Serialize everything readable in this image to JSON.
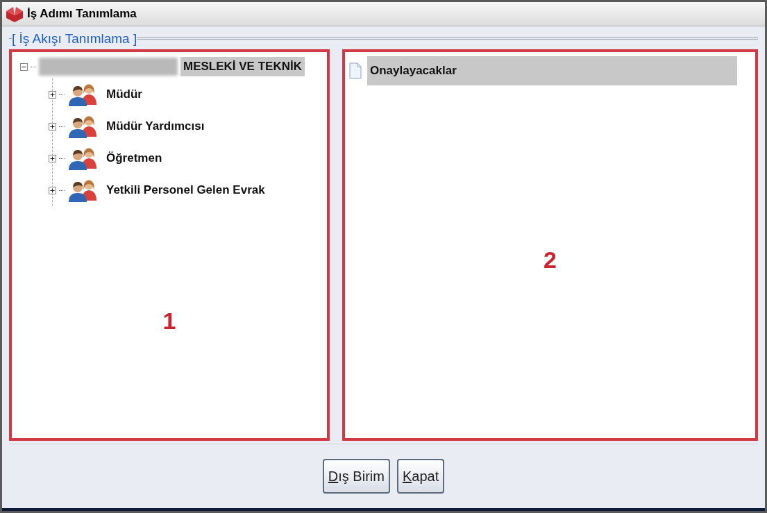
{
  "window": {
    "title": "İş Adımı Tanımlama"
  },
  "group": {
    "title": "[ İş Akışı Tanımlama ]"
  },
  "tree": {
    "root": {
      "label": "MESLEKİ VE TEKNİK",
      "expanded": true,
      "selected": true,
      "redacted": true,
      "children": [
        {
          "label": "Müdür",
          "expanded": false,
          "selected": false
        },
        {
          "label": "Müdür Yardımcısı",
          "expanded": false,
          "selected": false
        },
        {
          "label": "Öğretmen",
          "expanded": false,
          "selected": false
        },
        {
          "label": "Yetkili Personel Gelen Evrak",
          "expanded": false,
          "selected": false
        }
      ]
    }
  },
  "list": {
    "items": [
      {
        "label": "Onaylayacaklar",
        "selected": true
      }
    ]
  },
  "annotations": [
    "1",
    "2"
  ],
  "buttons": [
    "Dış Birim",
    "Kapat"
  ]
}
